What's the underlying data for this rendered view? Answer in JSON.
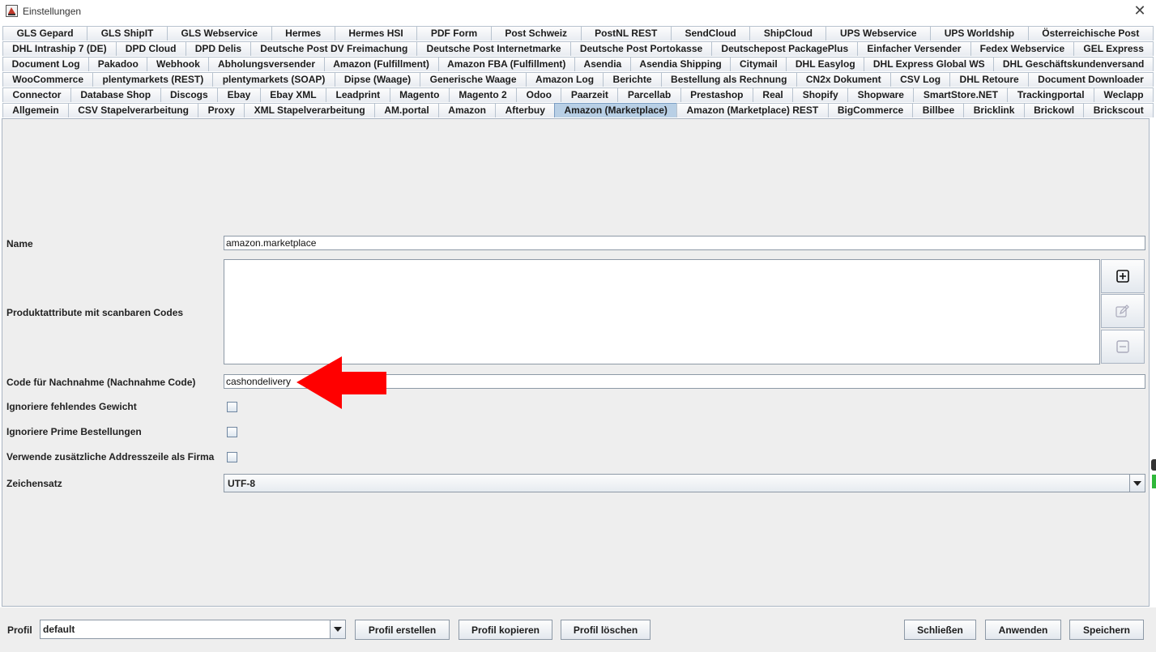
{
  "window": {
    "title": "Einstellungen",
    "close_glyph": "✕",
    "icon": "app-icon"
  },
  "tabs": {
    "rows": [
      [
        "GLS Gepard",
        "GLS ShipIT",
        "GLS Webservice",
        "Hermes",
        "Hermes HSI",
        "PDF Form",
        "Post Schweiz",
        "PostNL REST",
        "SendCloud",
        "ShipCloud",
        "UPS Webservice",
        "UPS Worldship",
        "Österreichische Post"
      ],
      [
        "DHL Intraship 7 (DE)",
        "DPD Cloud",
        "DPD Delis",
        "Deutsche Post DV Freimachung",
        "Deutsche Post Internetmarke",
        "Deutsche Post Portokasse",
        "Deutschepost PackagePlus",
        "Einfacher Versender",
        "Fedex Webservice",
        "GEL Express"
      ],
      [
        "Document Log",
        "Pakadoo",
        "Webhook",
        "Abholungsversender",
        "Amazon (Fulfillment)",
        "Amazon FBA (Fulfillment)",
        "Asendia",
        "Asendia Shipping",
        "Citymail",
        "DHL Easylog",
        "DHL Express Global WS",
        "DHL Geschäftskundenversand"
      ],
      [
        "WooCommerce",
        "plentymarkets (REST)",
        "plentymarkets (SOAP)",
        "Dipse (Waage)",
        "Generische Waage",
        "Amazon Log",
        "Berichte",
        "Bestellung als Rechnung",
        "CN2x Dokument",
        "CSV Log",
        "DHL Retoure",
        "Document Downloader"
      ],
      [
        "Connector",
        "Database Shop",
        "Discogs",
        "Ebay",
        "Ebay XML",
        "Leadprint",
        "Magento",
        "Magento 2",
        "Odoo",
        "Paarzeit",
        "Parcellab",
        "Prestashop",
        "Real",
        "Shopify",
        "Shopware",
        "SmartStore.NET",
        "Trackingportal",
        "Weclapp"
      ],
      [
        "Allgemein",
        "CSV Stapelverarbeitung",
        "Proxy",
        "XML Stapelverarbeitung",
        "AM.portal",
        "Amazon",
        "Afterbuy",
        "Amazon (Marketplace)",
        "Amazon (Marketplace) REST",
        "BigCommerce",
        "Billbee",
        "Bricklink",
        "Brickowl",
        "Brickscout"
      ]
    ],
    "selected": "Amazon (Marketplace)"
  },
  "form": {
    "name_label": "Name",
    "name_value": "amazon.marketplace",
    "attributes_label": "Produktattribute mit scanbaren Codes",
    "cod_label": "Code für Nachnahme (Nachnahme Code)",
    "cod_value": "cashondelivery",
    "ignore_weight_label": "Ignoriere fehlendes Gewicht",
    "ignore_prime_label": "Ignoriere Prime Bestellungen",
    "extra_address_label": "Verwende zusätzliche Addresszeile als Firma",
    "charset_label": "Zeichensatz",
    "charset_value": "UTF-8"
  },
  "icons": {
    "add": "plus-square-icon",
    "edit": "pencil-edit-icon",
    "remove": "minus-square-icon",
    "dropdown": "chevron-down-icon",
    "annotation": "red-arrow-icon"
  },
  "colors": {
    "selected_tab": "#b8cfe5",
    "annotation_red": "#ff0000",
    "panel_bg": "#eeeeee"
  },
  "bottom": {
    "profile_label": "Profil",
    "profile_value": "default",
    "create_profile": "Profil erstellen",
    "copy_profile": "Profil kopieren",
    "delete_profile": "Profil löschen",
    "close": "Schließen",
    "apply": "Anwenden",
    "save": "Speichern"
  }
}
